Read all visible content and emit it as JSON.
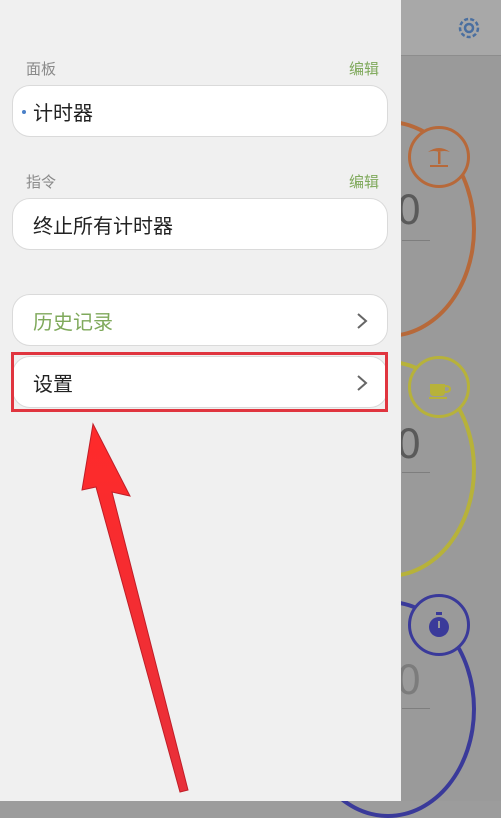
{
  "drawer": {
    "panel_section": {
      "title": "面板",
      "edit_label": "编辑",
      "item": "计时器"
    },
    "command_section": {
      "title": "指令",
      "edit_label": "编辑",
      "item": "终止所有计时器"
    },
    "menu": [
      {
        "label": "历史记录",
        "color": "#7fa95b"
      },
      {
        "label": "设置",
        "color": "#222222"
      }
    ]
  },
  "background": {
    "icons": [
      "gear-icon",
      "palm-tree-icon",
      "coffee-cup-icon",
      "stopwatch-icon"
    ],
    "digits": [
      "0",
      "0",
      "0"
    ]
  },
  "annotation": {
    "highlight_color": "#e0353f"
  }
}
